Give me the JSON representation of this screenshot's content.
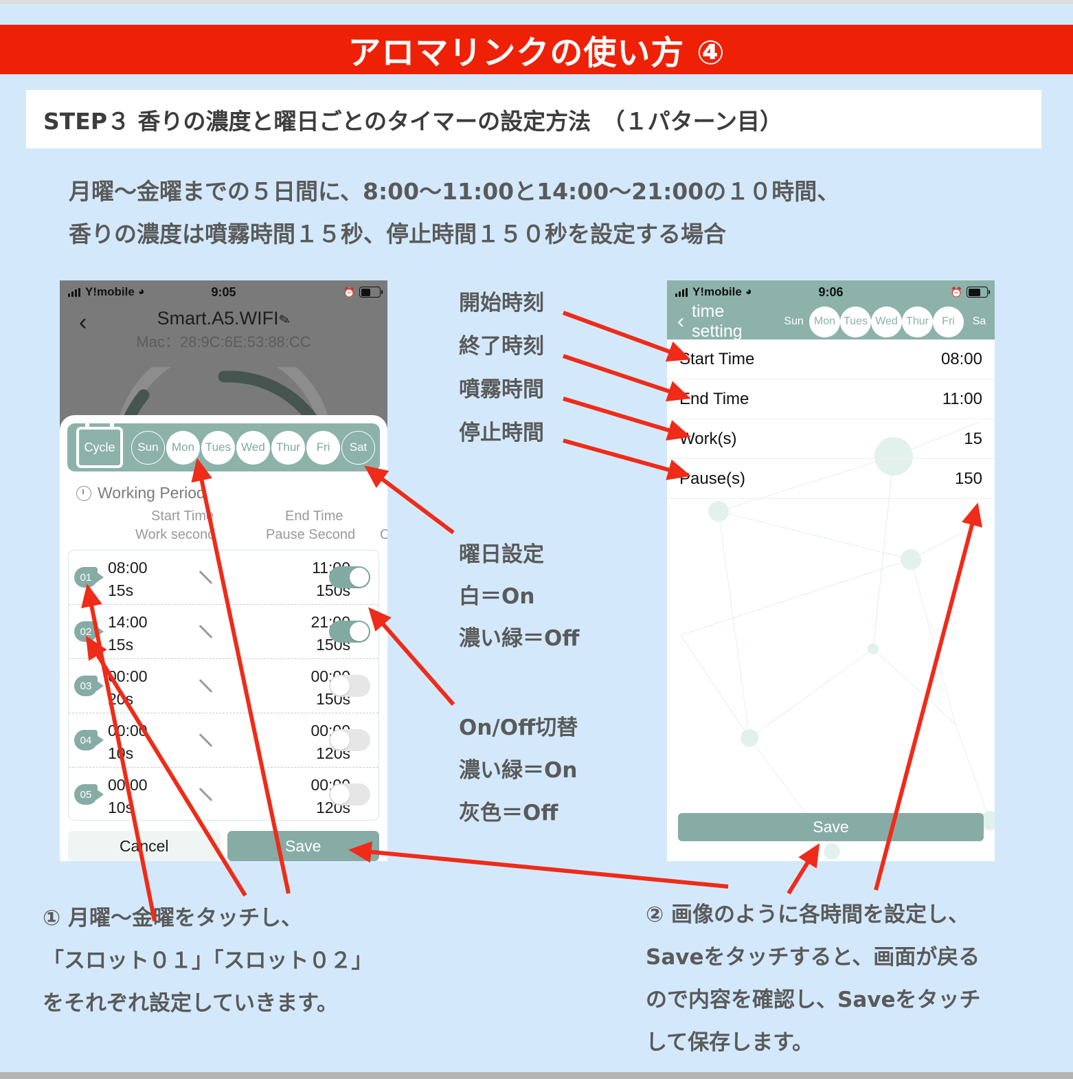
{
  "banner": {
    "title": "アロマリンクの使い方 ④"
  },
  "step": {
    "title": "STEP３ 香りの濃度と曜日ごとのタイマーの設定方法　（１パターン目）"
  },
  "intro": {
    "line1": "月曜～金曜までの５日間に、8:00～11:00と14:00～21:00の１０時間、",
    "line2": "香りの濃度は噴霧時間１５秒、停止時間１５０秒を設定する場合"
  },
  "phone_left": {
    "status": {
      "carrier": "Y!mobile",
      "time": "9:05",
      "signal_icon": "signal-bars-icon",
      "wifi_icon": "wifi-icon",
      "alarm_icon": "alarm-clock-icon",
      "battery_icon": "battery-icon"
    },
    "header": {
      "back_icon": "back-chevron-icon",
      "device_name": "Smart.A5.WIFI",
      "edit_icon": "pencil-icon",
      "mac": "Mac：28:9C:6E:53:88:CC"
    },
    "cycle": {
      "label": "Cycle",
      "icon": "calendar-icon"
    },
    "days": [
      {
        "label": "Sun",
        "selected": false
      },
      {
        "label": "Mon",
        "selected": true
      },
      {
        "label": "Tues",
        "selected": true
      },
      {
        "label": "Wed",
        "selected": true
      },
      {
        "label": "Thur",
        "selected": true
      },
      {
        "label": "Fri",
        "selected": true
      },
      {
        "label": "Sat",
        "selected": false
      }
    ],
    "working_period": {
      "title": "Working Period",
      "clock_icon": "clock-icon",
      "col_start": "Start Time",
      "col_end": "End Time",
      "col_work": "Work second",
      "col_pause": "Pause Second",
      "col_onoff": "On/Off"
    },
    "slots": [
      {
        "no": "01",
        "start": "08:00",
        "work": "15s",
        "end": "11:00",
        "pause": "150s",
        "on": true
      },
      {
        "no": "02",
        "start": "14:00",
        "work": "15s",
        "end": "21:00",
        "pause": "150s",
        "on": true
      },
      {
        "no": "03",
        "start": "00:00",
        "work": "20s",
        "end": "00:00",
        "pause": "150s",
        "on": false
      },
      {
        "no": "04",
        "start": "00:00",
        "work": "10s",
        "end": "00:00",
        "pause": "120s",
        "on": false
      },
      {
        "no": "05",
        "start": "00:00",
        "work": "10s",
        "end": "00:00",
        "pause": "120s",
        "on": false
      }
    ],
    "buttons": {
      "cancel": "Cancel",
      "save": "Save"
    }
  },
  "phone_right": {
    "status": {
      "carrier": "Y!mobile",
      "time": "9:06",
      "signal_icon": "signal-bars-icon",
      "wifi_icon": "wifi-icon",
      "alarm_icon": "alarm-clock-icon",
      "battery_icon": "battery-icon"
    },
    "nav": {
      "back_icon": "back-chevron-icon",
      "title": "time setting"
    },
    "days": [
      {
        "label": "Sun",
        "selected": false
      },
      {
        "label": "Mon",
        "selected": true
      },
      {
        "label": "Tues",
        "selected": true
      },
      {
        "label": "Wed",
        "selected": true
      },
      {
        "label": "Thur",
        "selected": true
      },
      {
        "label": "Fri",
        "selected": true
      },
      {
        "label": "Sa",
        "selected": false
      }
    ],
    "rows": [
      {
        "key": "Start Time",
        "value": "08:00"
      },
      {
        "key": "End Time",
        "value": "11:00"
      },
      {
        "key": "Work(s)",
        "value": "15"
      },
      {
        "key": "Pause(s)",
        "value": "150"
      }
    ],
    "save": "Save"
  },
  "annotations": {
    "a1": "開始時刻",
    "a2": "終了時刻",
    "a3": "噴霧時間",
    "a4": "停止時間",
    "b1": "曜日設定",
    "b2": "白＝On",
    "b3": "濃い緑＝Off",
    "c1": "On/Off切替",
    "c2": "濃い緑＝On",
    "c3": "灰色＝Off"
  },
  "footer_left": {
    "l1": "① 月曜～金曜をタッチし、",
    "l2": "「スロット０１」「スロット０２」",
    "l3": "をそれぞれ設定していきます。"
  },
  "footer_right": {
    "l1": "② 画像のように各時間を設定し、",
    "l2": "Saveをタッチすると、画面が戻る",
    "l3": "ので内容を確認し、Saveをタッチ",
    "l4": "して保存します。"
  },
  "colors": {
    "background": "#d3e9fb",
    "banner_red": "#ee2107",
    "teal": "#8cb2aa",
    "teal_dark": "#86aca5",
    "arrow_red": "#ef2b19",
    "text_gray": "#5a5a5a"
  }
}
